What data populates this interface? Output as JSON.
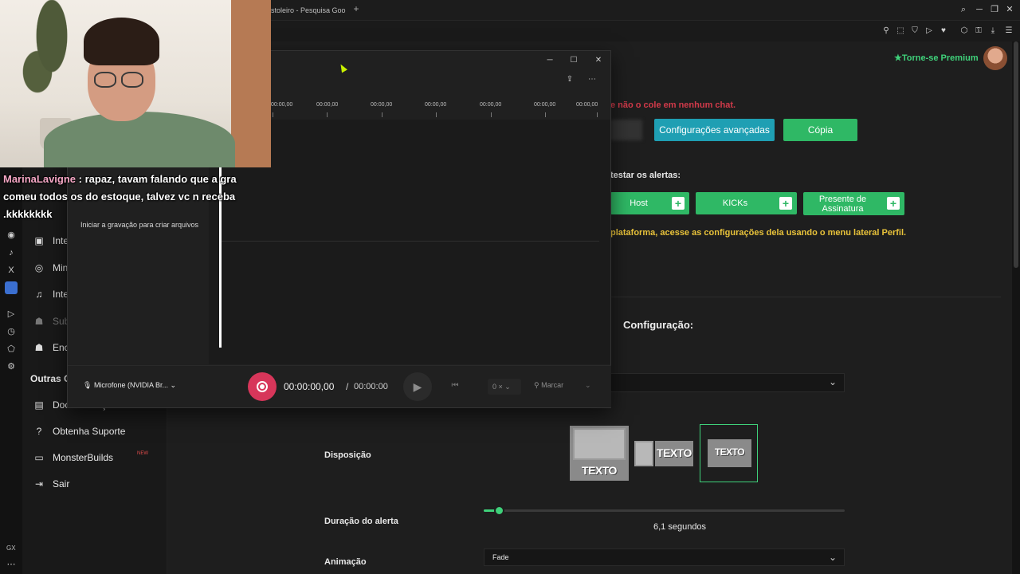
{
  "browser": {
    "tab_title": "stoleiro - Pesquisa Goo",
    "new_tab": "+",
    "search_glyph": "⌕",
    "minimize": "─",
    "maximize": "❐",
    "close": "✕"
  },
  "toolbar_icons": [
    "pin-icon",
    "snapshot-icon",
    "shield-icon",
    "play-icon",
    "heart-icon",
    "extensions-icon",
    "lock-icon",
    "download-icon",
    "menu-icon"
  ],
  "header": {
    "premium": "★Torne-se Premium"
  },
  "alerts": {
    "warning": "e não o cole em nenhum chat.",
    "advanced_button": "Configurações avançadas",
    "copy_button": "Cópia",
    "test_title": "testar os alertas:",
    "test_buttons": [
      "Host",
      "KICKs",
      "Presente de Assinatura"
    ],
    "plus": "+",
    "note": "plataforma, acesse as configurações dela usando o menu lateral Perfil."
  },
  "config": {
    "title": "Configuração:",
    "layout_label": "Disposição",
    "layout_text": "TEXTO",
    "duration_label": "Duração do alerta",
    "duration_fraction": 0.043,
    "duration_value": "6,1 segundos",
    "animation_label": "Animação",
    "animation_value": "Fade",
    "chevron": "⌄"
  },
  "sidebar": {
    "items": [
      {
        "icon": "interactions-icon",
        "glyph": "▣",
        "label": "Inte"
      },
      {
        "icon": "gamepad-icon",
        "glyph": "◎",
        "label": "Mini"
      },
      {
        "icon": "music-icon",
        "glyph": "♫",
        "label": "Inte"
      },
      {
        "icon": "users-icon",
        "glyph": "☗",
        "label": "Sub"
      },
      {
        "icon": "group-icon",
        "glyph": "☗",
        "label": "Enca"
      }
    ],
    "section_title": "Outras O",
    "bottom_items": [
      {
        "icon": "docs-icon",
        "glyph": "▤",
        "label": "Documentação"
      },
      {
        "icon": "help-icon",
        "glyph": "?",
        "label": "Obtenha Suporte"
      },
      {
        "icon": "laptop-icon",
        "glyph": "▭",
        "label": "MonsterBuilds"
      },
      {
        "icon": "logout-icon",
        "glyph": "⇥",
        "label": "Sair"
      }
    ],
    "beta_badge": "NEW"
  },
  "rail": {
    "glyphs": [
      "◉",
      "♪",
      "X",
      "▶",
      "▷",
      "◷",
      "⬠",
      "⚙"
    ],
    "bottom": "GX",
    "more": "⋯"
  },
  "recorder": {
    "empty_text": "Iniciar a gravação para criar arquivos",
    "ticks": [
      "00:00,00",
      "00:00,00",
      "00:00,00",
      "00:00,00",
      "00:00,00",
      "00:00,00",
      "00:00,00"
    ],
    "mic": "Microfone (NVIDIA Br...",
    "time_current": "00:00:00,00",
    "time_separator": "/",
    "time_total": "00:00:00",
    "speed": "0 ×",
    "mark": "Marcar",
    "share": "⇪",
    "more": "⋯"
  },
  "chat": {
    "user": "MarinaLavigne",
    "message": " : rapaz, tavam falando que a gra comeu todos os do estoque, talvez vc n receba .kkkkkkkk"
  },
  "colors": {
    "green": "#2fb865",
    "teal": "#1f9fb3",
    "warning_red": "#d23a4a",
    "note_yellow": "#e8c23a",
    "record_red": "#d7365a"
  }
}
